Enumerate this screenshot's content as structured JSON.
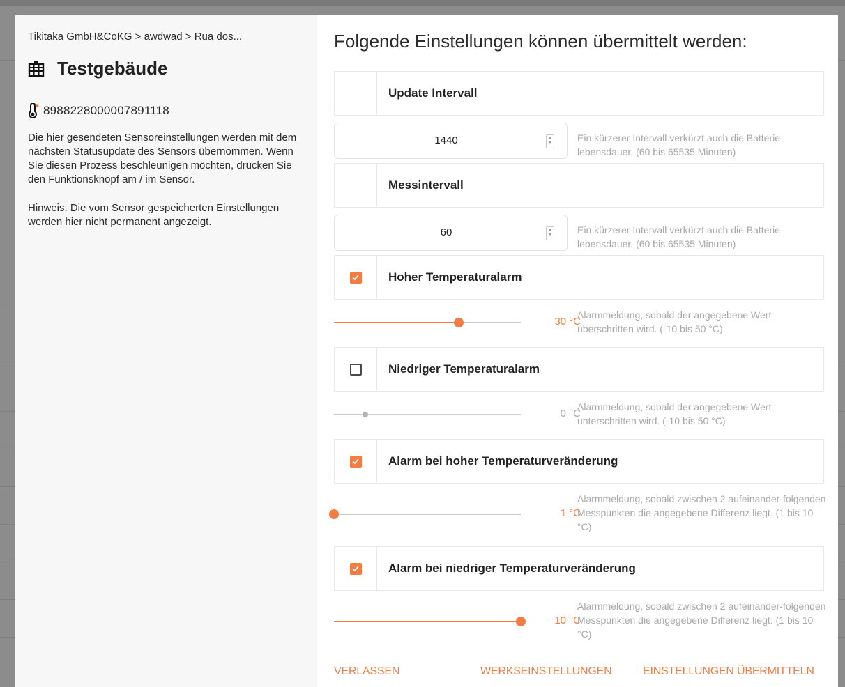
{
  "colors": {
    "accent": "#f37c43",
    "muted_text": "#a8a8a8",
    "border": "#e8e8e8"
  },
  "left": {
    "breadcrumb": "Tikitaka GmbH&CoKG > awdwad > Rua dos...",
    "building_icon": "building-icon",
    "building_name": "Testgebäude",
    "sensor_icon": "thermometer-icon",
    "sensor_id": "8988228000007891118",
    "description": "Die hier gesendeten Sensoreinstellungen werden mit dem nächsten Statusupdate des Sensors übernommen. Wenn Sie diesen Prozess beschleunigen möchten, drücken Sie den Funktionsknopf am / im Sensor.",
    "note": "Hinweis: Die vom Sensor gespeicherten Einstellungen werden hier nicht permanent angezeigt."
  },
  "right": {
    "heading": "Folgende Einstellungen können übermittelt werden:",
    "update_interval": {
      "title": "Update Intervall",
      "value": "1440",
      "hint": "Ein kürzerer Intervall verkürzt auch die Batterie-lebensdauer. (60 bis 65535 Minuten)"
    },
    "measure_interval": {
      "title": "Messintervall",
      "value": "60",
      "hint": "Ein kürzerer Intervall verkürzt auch die Batterie-lebensdauer. (60 bis 65535 Minuten)"
    },
    "high_temp_alarm": {
      "title": "Hoher Temperaturalarm",
      "checked": true,
      "value_label": "30 °C",
      "value": 30,
      "min": -10,
      "max": 50,
      "hint": "Alarmmeldung, sobald der angegebene Wert überschritten wird. (-10 bis 50 °C)"
    },
    "low_temp_alarm": {
      "title": "Niedriger Temperaturalarm",
      "checked": false,
      "value_label": "0 °C",
      "value": 0,
      "min": -10,
      "max": 50,
      "hint": "Alarmmeldung, sobald der angegebene Wert unterschritten wird. (-10 bis 50 °C)"
    },
    "high_change_alarm": {
      "title": "Alarm bei hoher Temperaturveränderung",
      "checked": true,
      "value_label": "1 °C",
      "value": 1,
      "min": 1,
      "max": 10,
      "hint": "Alarmmeldung, sobald zwischen 2 aufeinander-folgenden Messpunkten die angegebene Differenz liegt. (1 bis 10 °C)"
    },
    "low_change_alarm": {
      "title": "Alarm bei niedriger Temperaturveränderung",
      "checked": true,
      "value_label": "10 °C",
      "value": 10,
      "min": 1,
      "max": 10,
      "hint": "Alarmmeldung, sobald zwischen 2 aufeinander-folgenden Messpunkten die angegebene Differenz liegt. (1 bis 10 °C)"
    }
  },
  "footer": {
    "leave": "VERLASSEN",
    "factory_settings": "WERKSEINSTELLUNGEN",
    "submit": "EINSTELLUNGEN ÜBERMITTELN"
  }
}
